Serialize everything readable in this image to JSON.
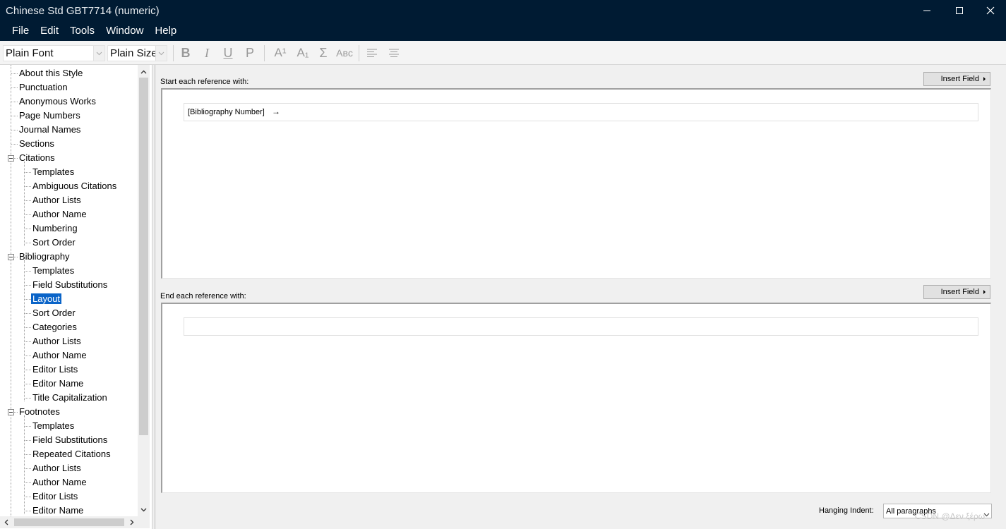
{
  "window": {
    "title": "Chinese Std GBT7714 (numeric)",
    "controls": [
      "minimize",
      "maximize",
      "close"
    ]
  },
  "menu": [
    "File",
    "Edit",
    "Tools",
    "Window",
    "Help"
  ],
  "toolbar": {
    "font_select": "Plain Font",
    "size_select": "Plain Size",
    "buttons": [
      {
        "name": "bold-button",
        "glyph": "B"
      },
      {
        "name": "italic-button",
        "glyph": "I"
      },
      {
        "name": "underline-button",
        "glyph": "U"
      },
      {
        "name": "plain-button",
        "glyph": "P"
      },
      {
        "name": "superscript-button",
        "glyph": "A¹"
      },
      {
        "name": "subscript-button",
        "glyph": "A₁"
      },
      {
        "name": "symbol-button",
        "glyph": "Σ"
      },
      {
        "name": "smallcaps-button",
        "glyph": "Aʙᴄ"
      },
      {
        "name": "align-left-button",
        "glyph": "≡"
      },
      {
        "name": "align-center-button",
        "glyph": "≡"
      }
    ]
  },
  "tree": [
    {
      "label": "About this Style",
      "level": 0
    },
    {
      "label": "Punctuation",
      "level": 0
    },
    {
      "label": "Anonymous Works",
      "level": 0
    },
    {
      "label": "Page Numbers",
      "level": 0
    },
    {
      "label": "Journal Names",
      "level": 0
    },
    {
      "label": "Sections",
      "level": 0
    },
    {
      "label": "Citations",
      "level": 0,
      "expanded": true
    },
    {
      "label": "Templates",
      "level": 1
    },
    {
      "label": "Ambiguous Citations",
      "level": 1
    },
    {
      "label": "Author Lists",
      "level": 1
    },
    {
      "label": "Author Name",
      "level": 1
    },
    {
      "label": "Numbering",
      "level": 1
    },
    {
      "label": "Sort Order",
      "level": 1
    },
    {
      "label": "Bibliography",
      "level": 0,
      "expanded": true
    },
    {
      "label": "Templates",
      "level": 1
    },
    {
      "label": "Field Substitutions",
      "level": 1
    },
    {
      "label": "Layout",
      "level": 1,
      "selected": true
    },
    {
      "label": "Sort Order",
      "level": 1
    },
    {
      "label": "Categories",
      "level": 1
    },
    {
      "label": "Author Lists",
      "level": 1
    },
    {
      "label": "Author Name",
      "level": 1
    },
    {
      "label": "Editor Lists",
      "level": 1
    },
    {
      "label": "Editor Name",
      "level": 1
    },
    {
      "label": "Title Capitalization",
      "level": 1
    },
    {
      "label": "Footnotes",
      "level": 0,
      "expanded": true
    },
    {
      "label": "Templates",
      "level": 1
    },
    {
      "label": "Field Substitutions",
      "level": 1
    },
    {
      "label": "Repeated Citations",
      "level": 1
    },
    {
      "label": "Author Lists",
      "level": 1
    },
    {
      "label": "Author Name",
      "level": 1
    },
    {
      "label": "Editor Lists",
      "level": 1
    },
    {
      "label": "Editor Name",
      "level": 1
    }
  ],
  "layout": {
    "start_label": "Start each reference with:",
    "start_insert": "Insert Field",
    "start_content": "[Bibliography Number]",
    "start_tab": "→",
    "end_label": "End each reference with:",
    "end_insert": "Insert Field",
    "end_content": "",
    "hanging_indent_label": "Hanging Indent:",
    "hanging_indent_value": "All paragraphs"
  },
  "watermark": "CSDN @Δεν ξέρω",
  "colors": {
    "titlebar": "#001b33",
    "selection": "#0a64c8"
  }
}
